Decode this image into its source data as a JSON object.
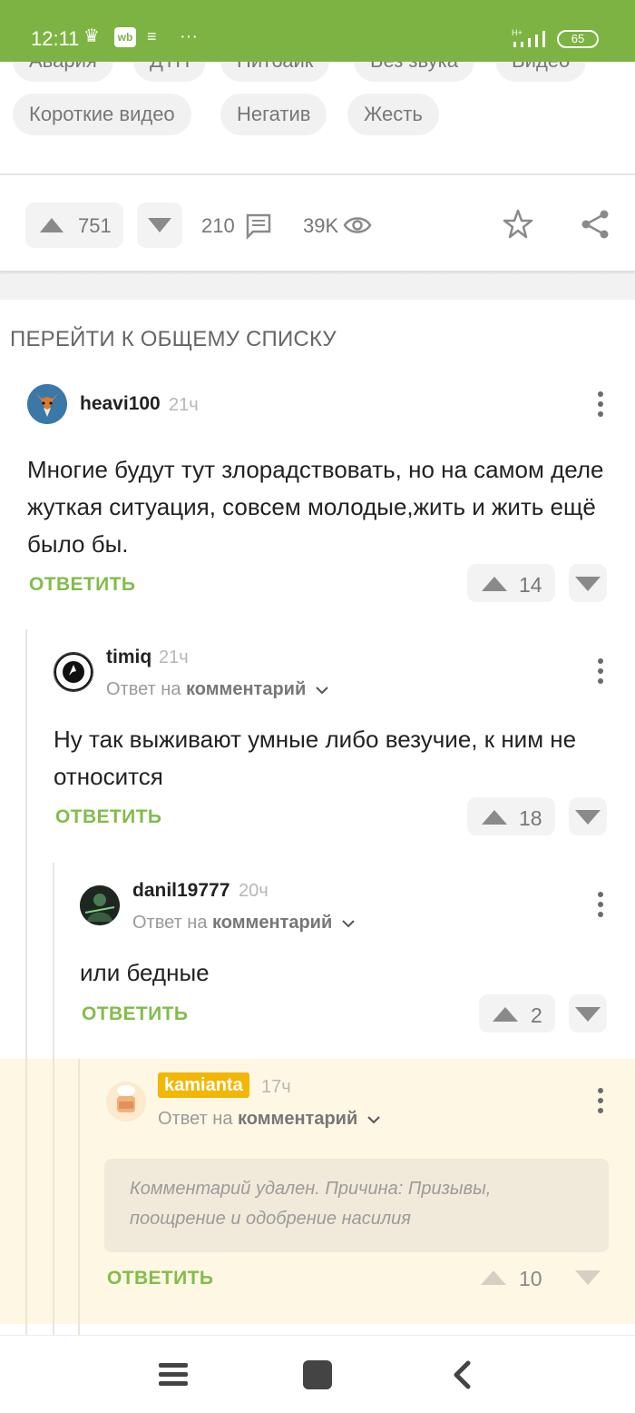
{
  "status_bar": {
    "time": "12:11",
    "battery": "65"
  },
  "tags_top": [
    "Авария",
    "ДТП",
    "Питбайк",
    "Без звука",
    "Видео"
  ],
  "tags": [
    "Короткие видео",
    "Негатив",
    "Жесть"
  ],
  "post_actions": {
    "upvotes": "751",
    "comments": "210",
    "views": "39K"
  },
  "section_title": "ПЕРЕЙТИ К ОБЩЕМУ СПИСКУ",
  "reply_label": "ОТВЕТИТЬ",
  "reply_to_prefix": "Ответ на",
  "reply_to_link": "комментарий",
  "comments": [
    {
      "username": "heavi100",
      "time": "21ч",
      "text": "Многие будут тут злорадствовать, но на самом деле жуткая ситуация, совсем молодые,жить и жить ещё было бы.",
      "votes": "14"
    },
    {
      "username": "timiq",
      "time": "21ч",
      "text": "Ну так выживают умные либо везучие, к ним не относится",
      "votes": "18"
    },
    {
      "username": "danil19777",
      "time": "20ч",
      "text": "или бедные",
      "votes": "2"
    },
    {
      "username": "kamianta",
      "time": "17ч",
      "deleted_text": "Комментарий удален. Причина: Призывы, поощрение и одобрение насилия",
      "votes": "10"
    }
  ],
  "colors": {
    "accent": "#82bd4b",
    "status_bar": "#7cb342",
    "highlight_bg": "#fdf7e4",
    "username_badge": "#f2b705"
  }
}
